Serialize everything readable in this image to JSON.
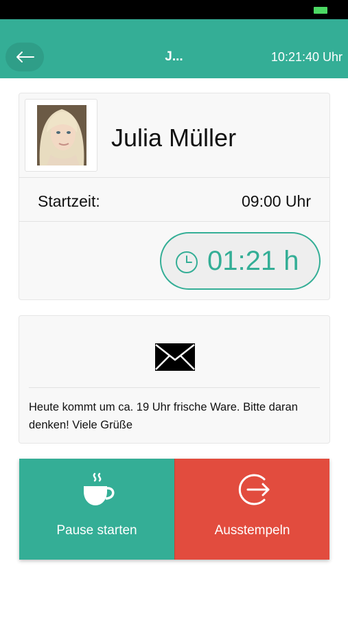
{
  "nav": {
    "title": "J...",
    "time": "10:21:40 Uhr"
  },
  "profile": {
    "name": "Julia Müller",
    "start_label": "Startzeit:",
    "start_value": "09:00 Uhr",
    "timer": "01:21 h"
  },
  "message": {
    "text": "Heute kommt um ca. 19 Uhr frische Ware. Bitte daran denken! Viele Grüße"
  },
  "actions": {
    "pause_label": "Pause starten",
    "checkout_label": "Ausstempeln"
  },
  "colors": {
    "accent": "#34ae96",
    "danger": "#e24c3e"
  },
  "icons": {
    "back": "arrow-left-icon",
    "timer": "clock-icon",
    "message": "mail-icon",
    "pause": "coffee-cup-icon",
    "checkout": "sign-out-icon"
  }
}
